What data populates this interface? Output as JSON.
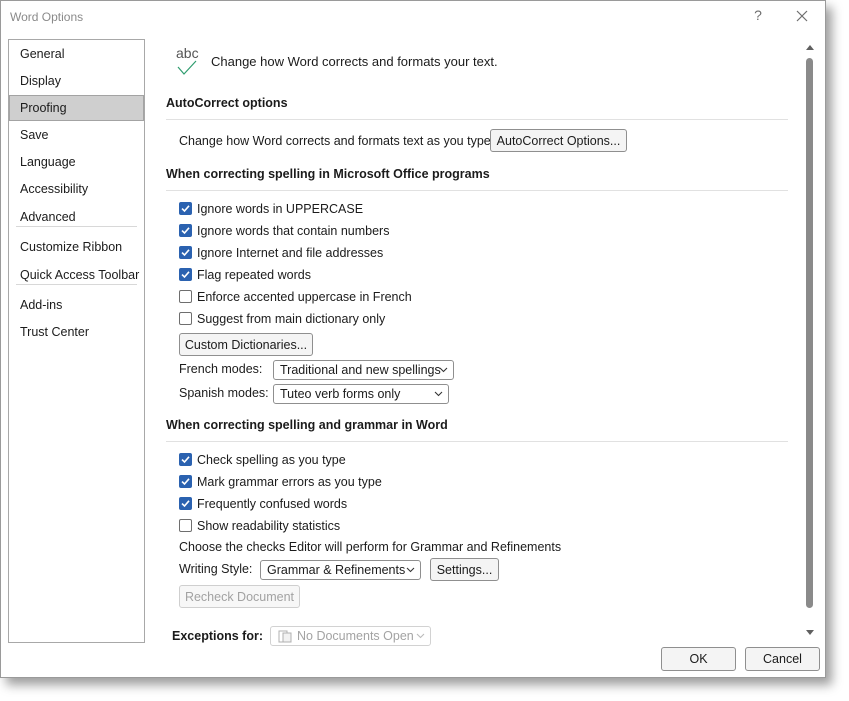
{
  "window": {
    "title": "Word Options",
    "help_glyph": "?"
  },
  "sidebar": {
    "items": [
      {
        "label": "General"
      },
      {
        "label": "Display"
      },
      {
        "label": "Proofing"
      },
      {
        "label": "Save"
      },
      {
        "label": "Language"
      },
      {
        "label": "Accessibility"
      },
      {
        "label": "Advanced"
      },
      {
        "label": "Customize Ribbon"
      },
      {
        "label": "Quick Access Toolbar"
      },
      {
        "label": "Add-ins"
      },
      {
        "label": "Trust Center"
      }
    ],
    "selected": "Proofing"
  },
  "header": {
    "icon_text": "abc",
    "text": "Change how Word corrects and formats your text."
  },
  "autocorrect": {
    "title": "AutoCorrect options",
    "description": "Change how Word corrects and formats text as you type:",
    "button": "AutoCorrect Options..."
  },
  "office_spelling": {
    "title": "When correcting spelling in Microsoft Office programs",
    "options": [
      {
        "label": "Ignore words in UPPERCASE",
        "checked": true
      },
      {
        "label": "Ignore words that contain numbers",
        "checked": true
      },
      {
        "label": "Ignore Internet and file addresses",
        "checked": true
      },
      {
        "label": "Flag repeated words",
        "checked": true
      },
      {
        "label": "Enforce accented uppercase in French",
        "checked": false
      },
      {
        "label": "Suggest from main dictionary only",
        "checked": false
      }
    ],
    "custom_dictionaries_button": "Custom Dictionaries...",
    "french_modes": {
      "label": "French modes:",
      "value": "Traditional and new spellings"
    },
    "spanish_modes": {
      "label": "Spanish modes:",
      "value": "Tuteo verb forms only"
    }
  },
  "word_spelling": {
    "title": "When correcting spelling and grammar in Word",
    "options": [
      {
        "label": "Check spelling as you type",
        "checked": true
      },
      {
        "label": "Mark grammar errors as you type",
        "checked": true
      },
      {
        "label": "Frequently confused words",
        "checked": true
      },
      {
        "label": "Show readability statistics",
        "checked": false
      }
    ],
    "editor_text": "Choose the checks Editor will perform for Grammar and Refinements",
    "writing_style": {
      "label": "Writing Style:",
      "value": "Grammar & Refinements"
    },
    "settings_button": "Settings...",
    "recheck_button": "Recheck Document"
  },
  "exceptions": {
    "label": "Exceptions for:",
    "value": "No Documents Open"
  },
  "footer": {
    "ok": "OK",
    "cancel": "Cancel"
  },
  "colors": {
    "checkbox_checked": "#2b62b0",
    "selected_nav": "#cfcfcf",
    "abc_check": "#2e9c6e"
  }
}
